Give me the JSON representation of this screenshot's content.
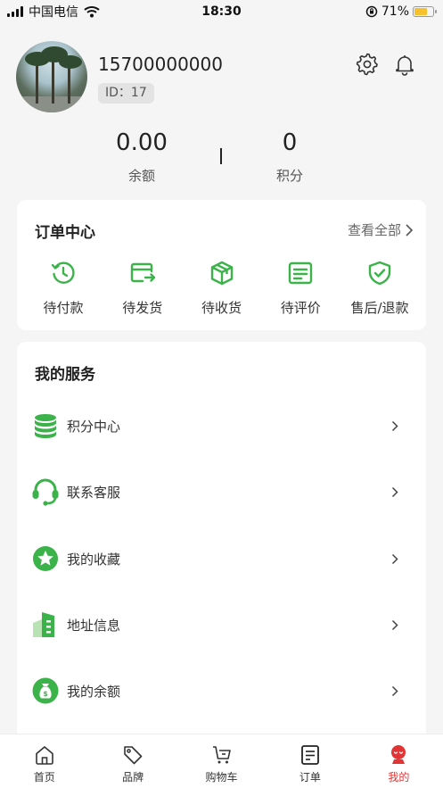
{
  "status_bar": {
    "carrier": "中国电信",
    "time": "18:30",
    "battery": "71%"
  },
  "profile": {
    "phone": "15700000000",
    "id_label": "ID：17"
  },
  "stats": {
    "balance_value": "0.00",
    "balance_label": "余额",
    "points_value": "0",
    "points_label": "积分"
  },
  "orders": {
    "title": "订单中心",
    "view_all": "查看全部",
    "items": [
      {
        "label": "待付款",
        "icon": "clock-icon"
      },
      {
        "label": "待发货",
        "icon": "shipping-card-icon"
      },
      {
        "label": "待收货",
        "icon": "box-icon"
      },
      {
        "label": "待评价",
        "icon": "review-icon"
      },
      {
        "label": "售后/退款",
        "icon": "shield-check-icon"
      }
    ]
  },
  "services": {
    "title": "我的服务",
    "items": [
      {
        "label": "积分中心",
        "icon": "coin-stack-icon"
      },
      {
        "label": "联系客服",
        "icon": "headset-icon"
      },
      {
        "label": "我的收藏",
        "icon": "star-icon"
      },
      {
        "label": "地址信息",
        "icon": "building-icon"
      },
      {
        "label": "我的余额",
        "icon": "money-bag-icon"
      }
    ]
  },
  "tabbar": {
    "items": [
      {
        "label": "首页",
        "icon": "home-icon"
      },
      {
        "label": "品牌",
        "icon": "tag-icon"
      },
      {
        "label": "购物车",
        "icon": "cart-icon"
      },
      {
        "label": "订单",
        "icon": "order-doc-icon"
      },
      {
        "label": "我的",
        "icon": "profile-icon"
      }
    ],
    "active": "我的"
  },
  "colors": {
    "accent_green": "#3cb34a",
    "active_red": "#e23434",
    "background": "#f5f5f5"
  }
}
